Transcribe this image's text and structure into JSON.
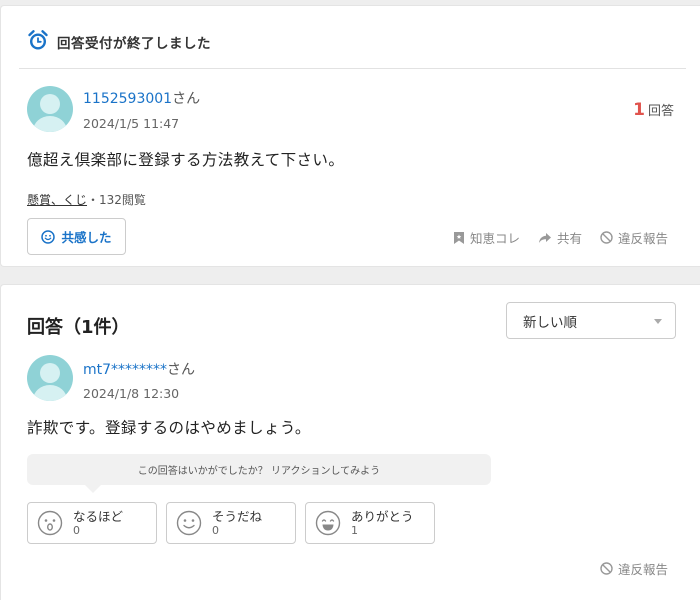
{
  "question": {
    "status": "回答受付が終了しました",
    "user": {
      "name": "1152593001",
      "suffix": "さん"
    },
    "date": "2024/1/5 11:47",
    "answer_count": {
      "num": "1",
      "unit": "回答"
    },
    "body": "億超え倶楽部に登録する方法教えて下さい。",
    "category": "懸賞、くじ",
    "views": "・132閲覧",
    "empathy_label": "共感した",
    "actions": {
      "chie_kore": "知恵コレ",
      "share": "共有",
      "report": "違反報告"
    }
  },
  "answers": {
    "title": "回答（1件）",
    "sort": {
      "selected": "新しい順"
    },
    "items": [
      {
        "user": {
          "name": "mt7********",
          "suffix": "さん"
        },
        "date": "2024/1/8 12:30",
        "body": "詐欺です。登録するのはやめましょう。",
        "reaction_prompt": "この回答はいかがでしたか？ リアクションしてみよう",
        "reactions": [
          {
            "label": "なるほど",
            "count": "0",
            "icon": "surprised-face-icon"
          },
          {
            "label": "そうだね",
            "count": "0",
            "icon": "smile-face-icon"
          },
          {
            "label": "ありがとう",
            "count": "1",
            "icon": "grin-face-icon"
          }
        ],
        "report": "違反報告"
      }
    ]
  },
  "colors": {
    "accent": "#1a73c8",
    "count_red": "#e0534d",
    "avatar": "#8fd2d6"
  }
}
